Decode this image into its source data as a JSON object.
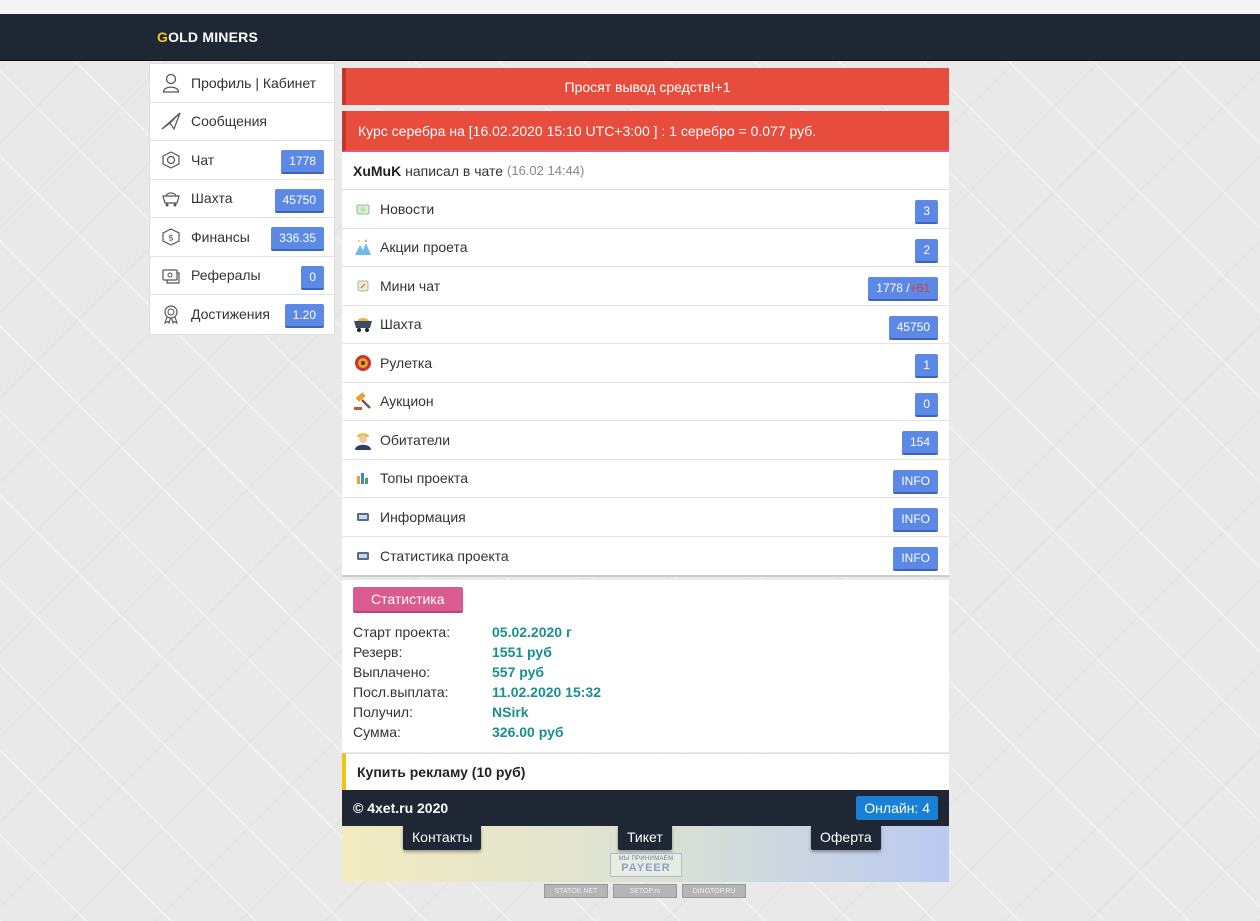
{
  "brand": {
    "first_letter": "G",
    "rest": "OLD MINERS",
    "accent": "#f3c623"
  },
  "sidebar": {
    "items": [
      {
        "icon": "user-icon",
        "label": "Профиль | Кабинет",
        "badge": ""
      },
      {
        "icon": "paper-plane-icon",
        "label": "Сообщения",
        "badge": ""
      },
      {
        "icon": "chat-coin-icon",
        "label": "Чат",
        "badge": "1778"
      },
      {
        "icon": "mine-cart-icon",
        "label": "Шахта",
        "badge": "45750"
      },
      {
        "icon": "money-icon",
        "label": "Финансы",
        "badge": "336.35"
      },
      {
        "icon": "referral-icon",
        "label": "Рефералы",
        "badge": "0"
      },
      {
        "icon": "medal-icon",
        "label": "Достижения",
        "badge": "1.20"
      }
    ]
  },
  "alerts": {
    "withdraw_text": "Просят вывод средств!",
    "withdraw_count": "+1",
    "rate_text": "Курс серебра на [16.02.2020 15:10 UTC+3:00 ] : 1 серебро = 0.077 руб."
  },
  "chat_line": {
    "user": "XuMuK",
    "text": "написал в чате",
    "time": "(16.02 14:44)"
  },
  "menu": {
    "items": [
      {
        "icon": "news-icon",
        "label": "Новости",
        "badge": "3"
      },
      {
        "icon": "promo-icon",
        "label": "Акции проета",
        "badge": "2"
      },
      {
        "icon": "mini-chat-icon",
        "label": "Мини чат",
        "badge": "1778 /",
        "badge_extra": "+61"
      },
      {
        "icon": "mine-cart-icon",
        "label": "Шахта",
        "badge": "45750"
      },
      {
        "icon": "roulette-icon",
        "label": "Рулетка",
        "badge": "1"
      },
      {
        "icon": "gavel-icon",
        "label": "Аукцион",
        "badge": "0"
      },
      {
        "icon": "worker-icon",
        "label": "Обитатели",
        "badge": "154"
      },
      {
        "icon": "top-icon",
        "label": "Топы проекта",
        "badge": "INFO"
      },
      {
        "icon": "info-icon",
        "label": "Информация",
        "badge": "INFO"
      },
      {
        "icon": "stats-icon",
        "label": "Статистика проекта",
        "badge": "INFO"
      }
    ]
  },
  "stats": {
    "button": "Статистика",
    "rows": [
      {
        "key": "Старт проекта:",
        "value": "05.02.2020 г"
      },
      {
        "key": "Резерв:",
        "value": "1551 руб"
      },
      {
        "key": "Выплачено:",
        "value": "557 руб"
      },
      {
        "key": "Посл.выплата:",
        "value": "11.02.2020 15:32"
      },
      {
        "key": "Получил:",
        "value": "NSirk"
      },
      {
        "key": "Сумма:",
        "value": "326.00 руб"
      }
    ]
  },
  "buy_ad": "Купить рекламу (10 руб)",
  "footer": {
    "copyright": "© 4xet.ru 2020",
    "online": "Онлайн: 4"
  },
  "links": {
    "contacts": "Контакты",
    "ticket": "Тикет",
    "offer": "Оферта"
  },
  "payeer": {
    "small": "МЫ ПРИНИМАЕМ",
    "big": "PAYEER"
  },
  "counters": [
    "STATOK.NET",
    "SETOP.ru",
    "DINOTOP.RU"
  ]
}
